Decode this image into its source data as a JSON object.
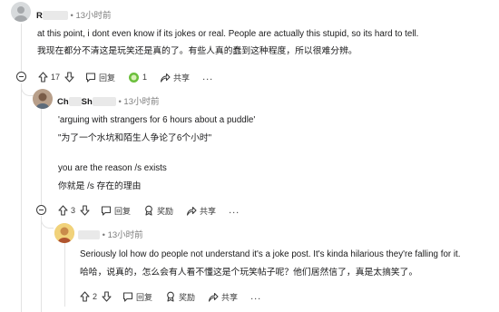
{
  "comment1": {
    "username": "R",
    "time": "13小时前",
    "text_en": "at this point, i dont even know if its jokes or real. People are actually this stupid, so its hard to tell.",
    "text_zh": "我现在都分不清这是玩笑还是真的了。有些人真的蠢到这种程度，所以很难分辨。",
    "votes": "17",
    "award_count": "1",
    "reply_label": "回复",
    "share_label": "共享"
  },
  "comment2": {
    "username": "Ch",
    "username_mid": "Sh",
    "time": "13小时前",
    "quote_en": "'arguing with strangers for 6 hours about a puddle'",
    "quote_zh": "\"为了一个水坑和陌生人争论了6个小时\"",
    "text_en": "you are the reason /s exists",
    "text_zh": "你就是 /s 存在的理由",
    "votes": "3",
    "reply_label": "回复",
    "award_label": "奖励",
    "share_label": "共享"
  },
  "comment3": {
    "time": "13小时前",
    "text_en": "Seriously lol how do people not understand it's a joke post. It's kinda hilarious they're falling for it.",
    "text_zh": "哈哈，说真的，怎么会有人看不懂这是个玩笑帖子呢？他们居然信了，真是太搞笑了。",
    "votes": "2",
    "reply_label": "回复",
    "award_label": "奖励",
    "share_label": "共享"
  },
  "meta": {
    "separator": "•",
    "collapse_mark": "..."
  },
  "colors": {
    "award": "#6cbf3d",
    "muted": "#7c7c7c",
    "line": "#e3e3e3"
  },
  "icons": [
    "upvote-icon",
    "downvote-icon",
    "reply-icon",
    "award-icon",
    "share-icon",
    "more-icon",
    "collapse-icon"
  ]
}
